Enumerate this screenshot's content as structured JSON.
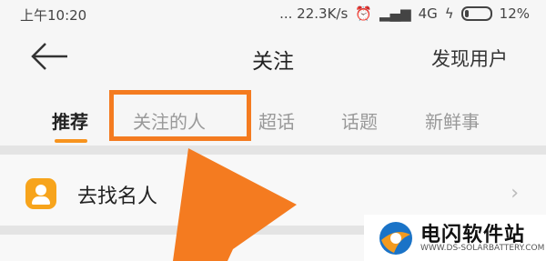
{
  "status_bar": {
    "time": "上午10:20",
    "network_speed": "... 22.3K/s",
    "alarm_icon": "alarm-icon",
    "signal_icon": "signal-icon",
    "wifi_icon": "wifi-icon",
    "network_type": "4G",
    "battery_percent": "12%"
  },
  "nav": {
    "back_icon": "back-arrow-icon",
    "title": "关注",
    "right_action": "发现用户"
  },
  "tabs": [
    {
      "label": "推荐",
      "active": true
    },
    {
      "label": "关注的人",
      "active": false
    },
    {
      "label": "超话",
      "active": false
    },
    {
      "label": "话题",
      "active": false
    },
    {
      "label": "新鲜事",
      "active": false
    }
  ],
  "list": {
    "find_celebrities": {
      "icon": "user-icon",
      "label": "去找名人"
    }
  },
  "colors": {
    "accent": "#f7931e",
    "highlight_box": "#f47b20",
    "arrow": "#f47b20"
  },
  "watermark": {
    "title": "电闪软件站",
    "url": "WWW.DS-SOLARBATTERY.COM"
  }
}
